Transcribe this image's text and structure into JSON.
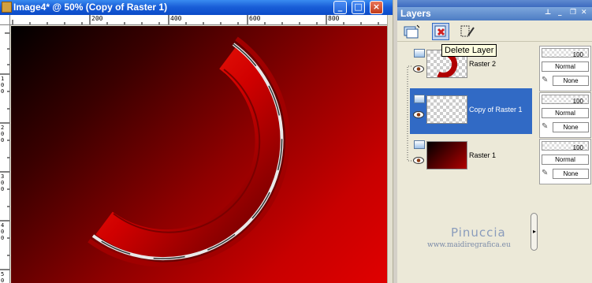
{
  "window": {
    "title": "Image4* @  50% (Copy of Raster 1)",
    "minimize": "_",
    "maximize": "□",
    "close": "×"
  },
  "ruler": {
    "top": [
      "200",
      "400",
      "600",
      "800"
    ],
    "left": [
      "100",
      "200",
      "300",
      "400",
      "500"
    ]
  },
  "layers": {
    "title": "Layers",
    "tooltip": "Delete Layer",
    "items": [
      {
        "name": "Raster 2",
        "selected": false
      },
      {
        "name": "Copy of Raster 1",
        "selected": true
      },
      {
        "name": "Raster 1",
        "selected": false
      }
    ],
    "props": [
      {
        "opacity": "100",
        "blend": "Normal",
        "mode": "None"
      },
      {
        "opacity": "100",
        "blend": "Normal",
        "mode": "None"
      },
      {
        "opacity": "100",
        "blend": "Normal",
        "mode": "None"
      }
    ],
    "watermark": {
      "line1": "Pinuccia",
      "line2": "www.maidiregrafica.eu"
    }
  },
  "colors": {
    "titlebar": "#1a5fd8",
    "selection": "#316ac5",
    "canvas_red": "#c80000"
  }
}
